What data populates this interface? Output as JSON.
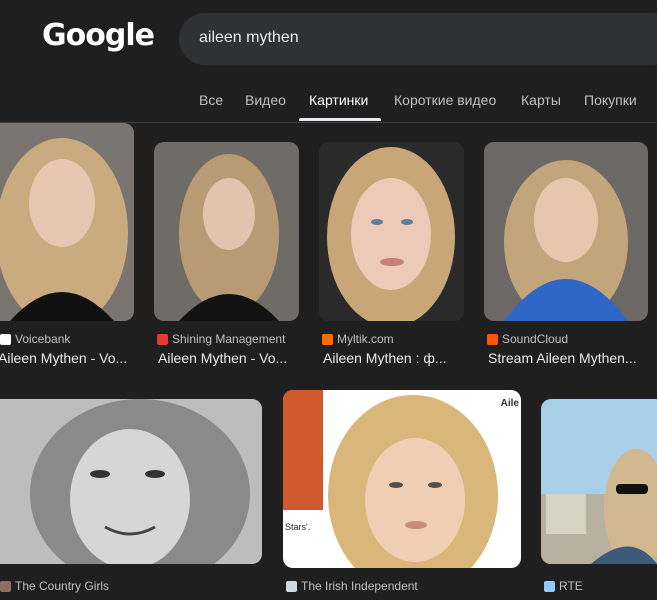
{
  "header": {
    "logo_text": "Google",
    "search_query": "aileen mythen"
  },
  "tabs": [
    {
      "label": "Все"
    },
    {
      "label": "Видео"
    },
    {
      "label": "Картинки",
      "active": true
    },
    {
      "label": "Короткие видео"
    },
    {
      "label": "Карты"
    },
    {
      "label": "Покупки"
    }
  ],
  "results_row1": [
    {
      "source": "Voicebank",
      "title": "Aileen Mythen - Vo...",
      "favicon_color": "#ffffff"
    },
    {
      "source": "Shining Management",
      "title": "Aileen Mythen - Vo...",
      "favicon_color": "#e53935"
    },
    {
      "source": "Myltik.com",
      "title": "Aileen Mythen : ф...",
      "favicon_color": "#ff6d00"
    },
    {
      "source": "SoundCloud",
      "title": "Stream Aileen Mythen...",
      "favicon_color": "#ff5500"
    }
  ],
  "results_row2": [
    {
      "source": "The Country Girls",
      "favicon_color": "#8d6e63"
    },
    {
      "source": "The Irish Independent",
      "favicon_color": "#cfd8dc"
    },
    {
      "source": "RTE",
      "favicon_color": "#90caf9"
    }
  ],
  "image_texts": {
    "irish_overlay_top": "Aile",
    "irish_overlay_side": "Stars'."
  },
  "colors": {
    "background": "#1f1f1f",
    "search_bg": "#303134",
    "text_primary": "#e8eaed",
    "text_secondary": "#bdc1c6"
  }
}
